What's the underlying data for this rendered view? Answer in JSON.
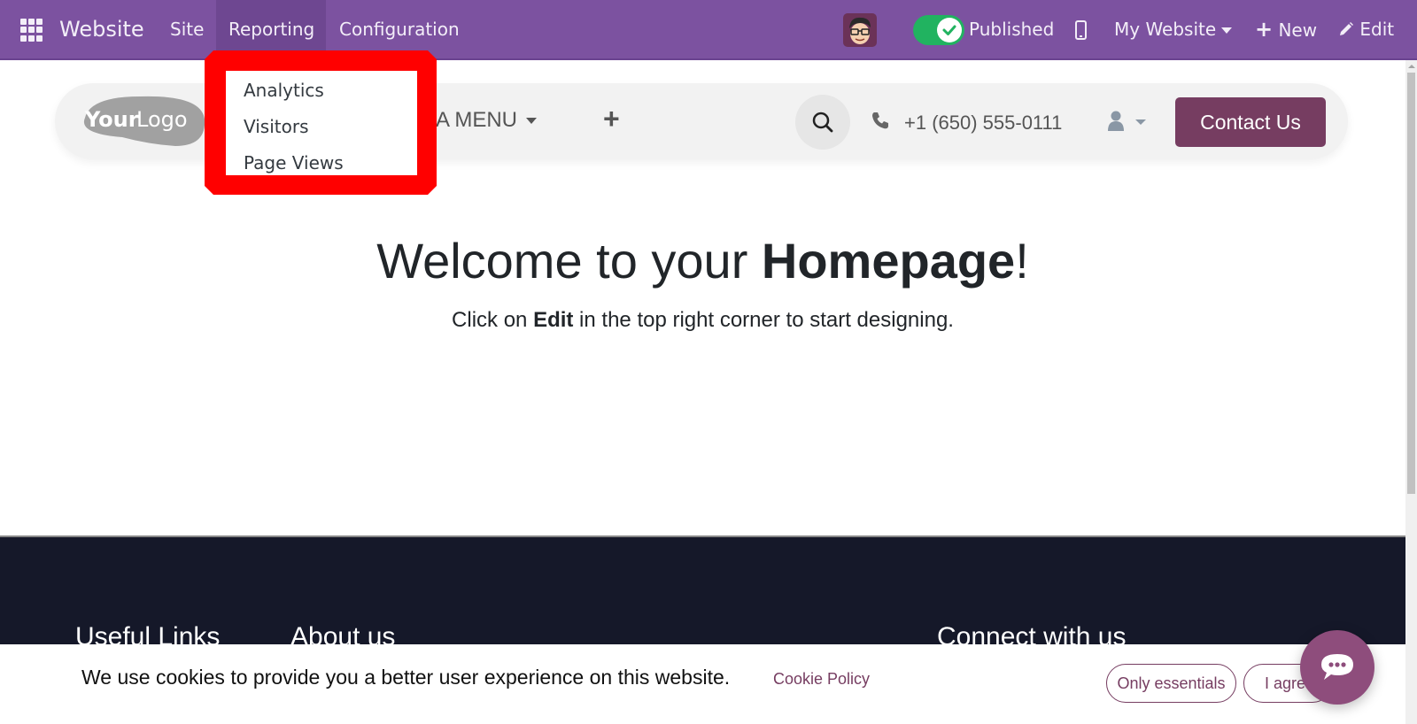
{
  "topbar": {
    "app_name": "Website",
    "menu": [
      {
        "label": "Site"
      },
      {
        "label": "Reporting"
      },
      {
        "label": "Configuration"
      }
    ],
    "published_label": "Published",
    "website_selector": "My Website",
    "new_label": "New",
    "edit_label": "Edit",
    "accent_color": "#7c52a0"
  },
  "reporting_dropdown": {
    "items": [
      {
        "label": "Analytics"
      },
      {
        "label": "Visitors"
      },
      {
        "label": "Page Views"
      }
    ],
    "highlight_color": "#ff0000"
  },
  "site_header": {
    "logo_text_bold": "Your",
    "logo_text_light": "Logo",
    "mega_menu_label": "A MENU",
    "phone": "+1 (650) 555-0111",
    "contact_label": "Contact Us",
    "brand_color": "#763d61"
  },
  "hero": {
    "title_prefix": "Welcome to your ",
    "title_bold": "Homepage",
    "title_suffix": "!",
    "subtitle_prefix": "Click on ",
    "subtitle_bold": "Edit",
    "subtitle_suffix": " in the top right corner to start designing."
  },
  "footer": {
    "headings": [
      "Useful Links",
      "About us",
      "Connect with us"
    ]
  },
  "cookie_bar": {
    "message": "We use cookies to provide you a better user experience on this website.",
    "policy_link": "Cookie Policy",
    "only_essentials": "Only essentials",
    "agree": "I agree"
  }
}
